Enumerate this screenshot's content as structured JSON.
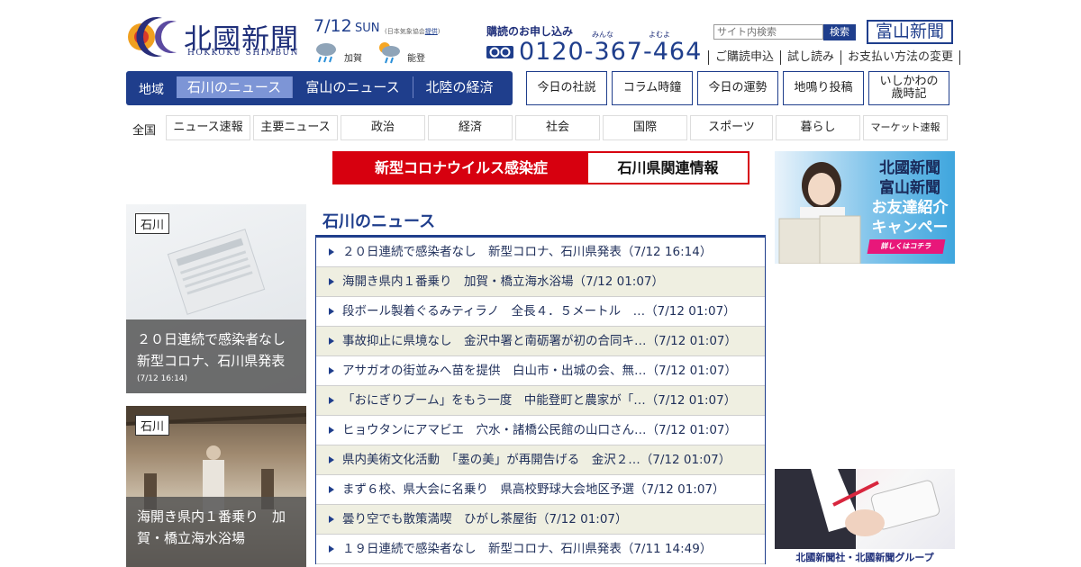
{
  "header": {
    "logo_title": "北國新聞",
    "logo_sub": "HOKKOKU SHIMBUN",
    "date": "7/12",
    "weekday": "SUN",
    "weather_note_prefix": "(日本気象協会",
    "weather_note_link": "提供",
    "weather_note_suffix": ")",
    "weather": [
      {
        "city": "加賀",
        "icon": "rain-icon"
      },
      {
        "city": "能登",
        "icon": "sun-rain-icon"
      }
    ],
    "subscribe_title": "購読のお申し込み",
    "ruby_minna": "みんな",
    "ruby_yomu": "よむよ",
    "phone": "0120-367-464",
    "search_placeholder": "サイト内検索",
    "search_button": "検索",
    "toyama_logo": "富山新聞",
    "sublinks": [
      "ご購読申込",
      "試し読み",
      "お支払い方法の変更"
    ]
  },
  "region_nav": {
    "label": "地域",
    "tabs": [
      "石川のニュース",
      "富山のニュース",
      "北陸の経済"
    ],
    "active_index": 0
  },
  "box_links": [
    "今日の社説",
    "コラム時鐘",
    "今日の運勢",
    "地鳴り投稿",
    "いしかわの\n歳時記"
  ],
  "category_nav": {
    "all": "全国",
    "items": [
      "ニュース速報",
      "主要ニュース",
      "政治",
      "経済",
      "社会",
      "国際",
      "スポーツ",
      "暮らし",
      "マーケット速報"
    ]
  },
  "corona_banner": {
    "left": "新型コロナウイルス感染症",
    "right": "石川県関連情報"
  },
  "features": [
    {
      "tag": "石川",
      "title": "２０日連続で感染者なし　新型コロナ、石川県発表",
      "time": "(7/12 16:14)"
    },
    {
      "tag": "石川",
      "title": "海開き県内１番乗り　加賀・橋立海水浴場",
      "time": ""
    }
  ],
  "news": {
    "section_title": "石川のニュース",
    "items": [
      "２０日連続で感染者なし　新型コロナ、石川県発表（7/12 16:14）",
      "海開き県内１番乗り　加賀・橋立海水浴場（7/12 01:07）",
      "段ボール製着ぐるみティラノ　全長４．５メートル　…（7/12 01:07）",
      "事故抑止に県境なし　金沢中署と南砺署が初の合同キ…（7/12 01:07）",
      "アサガオの街並みへ苗を提供　白山市・出城の会、無…（7/12 01:07）",
      "「おにぎりブーム」をもう一度　中能登町と農家が「…（7/12 01:07）",
      "ヒョウタンにアマビエ　穴水・諸橋公民館の山口さん…（7/12 01:07）",
      "県内美術文化活動　「墨の美」が再開告げる　金沢２…（7/12 01:07）",
      "まず６校、県大会に名乗り　県高校野球大会地区予選（7/12 01:07）",
      "曇り空でも散策満喫　ひがし茶屋街（7/12 01:07）",
      "１９日連続で感染者なし　新型コロナ、石川県発表（7/11 14:49）"
    ]
  },
  "ads": {
    "campaign": {
      "line1": "北國新聞",
      "line2": "富山新聞",
      "line3": "お友達紹介",
      "line4": "キャンペーン",
      "button": "詳しくはコチラ"
    },
    "group": {
      "caption": "北國新聞社・北國新聞グループ"
    }
  },
  "colors": {
    "brand": "#1f3e8c",
    "accent": "#d7000f",
    "row_alt": "#efefe1"
  }
}
